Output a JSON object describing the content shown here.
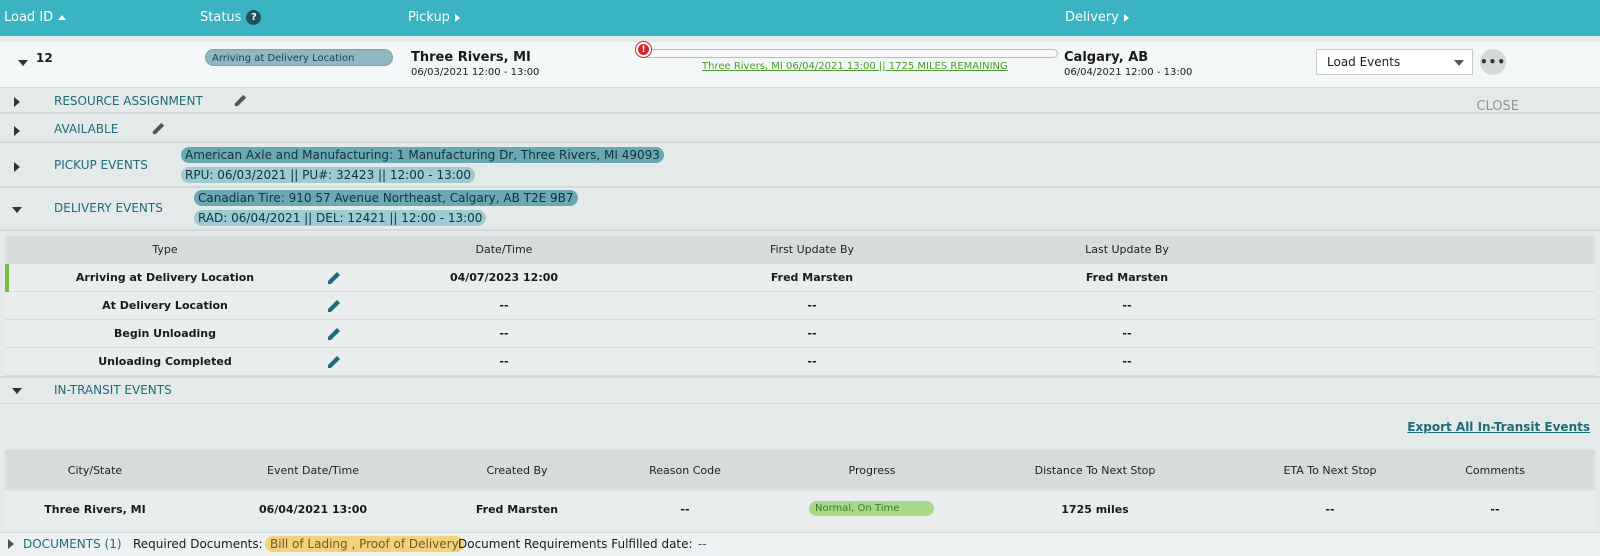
{
  "header": {
    "load_id": "Load ID",
    "status": "Status",
    "status_help": "?",
    "pickup": "Pickup",
    "delivery": "Delivery"
  },
  "load": {
    "id": "12",
    "status": "Arriving at Delivery Location",
    "pickup_city": "Three Rivers, MI",
    "pickup_time": "06/03/2021 12:00 - 13:00",
    "progress_alert": "!",
    "progress_text": "Three Rivers, MI 06/04/2021 13:00 || 1725 MILES REMAINING",
    "delivery_city": "Calgary, AB",
    "delivery_time": "06/04/2021 12:00 - 13:00",
    "events_select": "Load Events",
    "more": "•••"
  },
  "sections": {
    "resource_assignment": "RESOURCE ASSIGNMENT",
    "available": "AVAILABLE",
    "close": "CLOSE",
    "pickup_events": "PICKUP EVENTS",
    "pickup_address": "American Axle and Manufacturing: 1 Manufacturing Dr, Three Rivers, MI 49093",
    "pickup_detail": "RPU: 06/03/2021 || PU#: 32423 || 12:00 - 13:00",
    "delivery_events": "DELIVERY EVENTS",
    "delivery_address": "Canadian Tire: 910 57 Avenue Northeast, Calgary, AB T2E 9B7",
    "delivery_detail": "RAD: 06/04/2021 || DEL: 12421 || 12:00 - 13:00",
    "in_transit_events": "IN-TRANSIT EVENTS"
  },
  "delivery_table": {
    "headers": [
      "Type",
      "Date/Time",
      "First Update By",
      "Last Update By"
    ],
    "rows": [
      {
        "type": "Arriving at Delivery Location",
        "datetime": "04/07/2023 12:00",
        "first": "Fred Marsten",
        "last": "Fred Marsten"
      },
      {
        "type": "At Delivery Location",
        "datetime": "--",
        "first": "--",
        "last": "--"
      },
      {
        "type": "Begin Unloading",
        "datetime": "--",
        "first": "--",
        "last": "--"
      },
      {
        "type": "Unloading Completed",
        "datetime": "--",
        "first": "--",
        "last": "--"
      }
    ]
  },
  "transit": {
    "export_link": "Export All In-Transit Events",
    "headers": [
      "City/State",
      "Event Date/Time",
      "Created By",
      "Reason Code",
      "Progress",
      "Distance To Next Stop",
      "ETA To Next Stop",
      "Comments"
    ],
    "row": {
      "city": "Three Rivers, MI",
      "datetime": "06/04/2021 13:00",
      "created_by": "Fred Marsten",
      "reason": "--",
      "progress": "Normal, On Time",
      "distance": "1725 miles",
      "eta": "--",
      "comments": "--"
    }
  },
  "documents": {
    "label": "DOCUMENTS (1)",
    "required_label": "Required Documents:",
    "required_value": "Bill of Lading , Proof of Delivery",
    "fulfilled_label": "Document Requirements Fulfilled date:",
    "fulfilled_value": "--"
  },
  "colors": {
    "header": "#3ab3c3",
    "accent": "#1e6c7a",
    "active_bar": "#7ac143",
    "alert": "#d7262b"
  }
}
